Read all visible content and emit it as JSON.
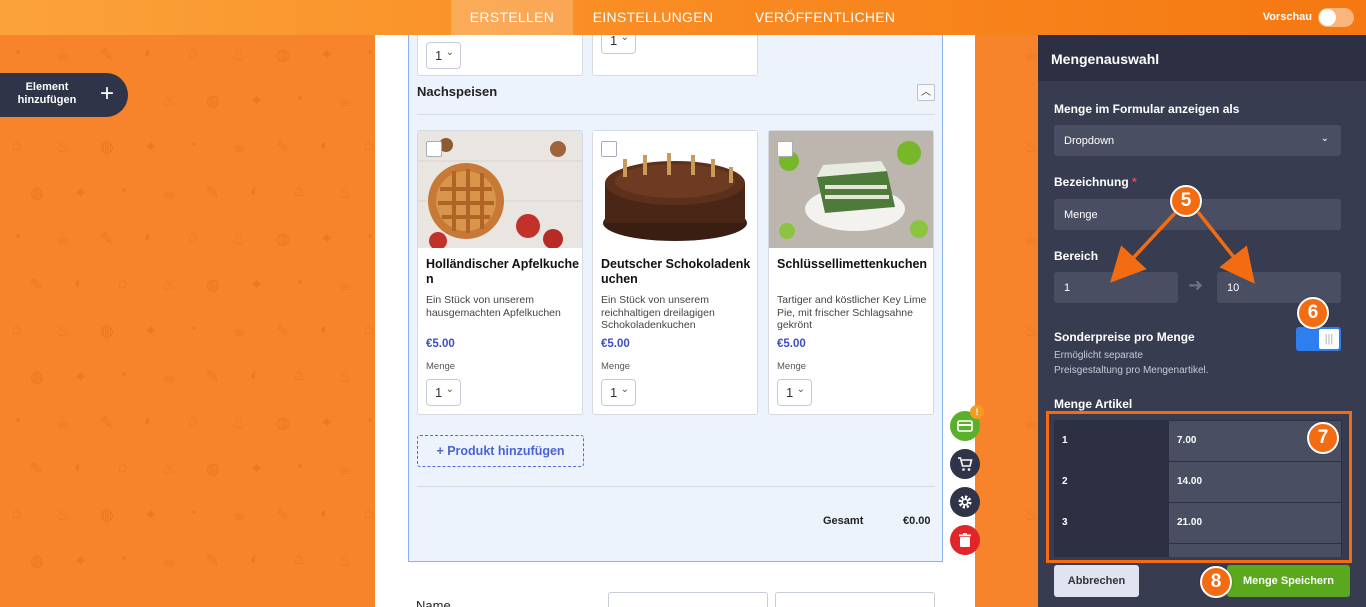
{
  "topbar": {
    "tabs": [
      {
        "label": "ERSTELLEN",
        "active": true
      },
      {
        "label": "EINSTELLUNGEN",
        "active": false
      },
      {
        "label": "VERÖFFENTLICHEN",
        "active": false
      }
    ],
    "preview_label": "Vorschau"
  },
  "sidebar": {
    "add_element_label": "Element hinzufügen"
  },
  "form": {
    "top_qty_values": [
      "1",
      "1"
    ],
    "section_title": "Nachspeisen",
    "products": [
      {
        "name": "Holländischer Apfelkuchen",
        "description": "Ein Stück von unserem hausgemachten Apfelkuchen",
        "price": "€5.00",
        "qty_label": "Menge",
        "qty_value": "1"
      },
      {
        "name": "Deutscher Schokoladenkuchen",
        "description": "Ein Stück von unserem reichhaltigen dreilagigen Schokoladenkuchen",
        "price": "€5.00",
        "qty_label": "Menge",
        "qty_value": "1"
      },
      {
        "name": "Schlüssellimettenkuchen",
        "description": "Tartiger and köstlicher Key Lime Pie, mit frischer Schlagsahne gekrönt",
        "price": "€5.00",
        "qty_label": "Menge",
        "qty_value": "1"
      }
    ],
    "add_product_label": "+ Produkt hinzufügen",
    "total_label": "Gesamt",
    "total_value": "€0.00",
    "name_label": "Name",
    "fab_badge": "!"
  },
  "panel": {
    "title": "Mengenauswahl",
    "display_as_label": "Menge im Formular anzeigen als",
    "display_as_value": "Dropdown",
    "label_label": "Bezeichnung",
    "label_required": "*",
    "label_value": "Menge",
    "range_label": "Bereich",
    "range_from": "1",
    "range_to": "10",
    "special_price_label": "Sonderpreise pro Menge",
    "special_price_desc_1": "Ermöglicht separate",
    "special_price_desc_2": "Preisgestaltung pro Mengenartikel.",
    "special_price_enabled": true,
    "table_label": "Menge Artikel",
    "rows": [
      {
        "qty": "1",
        "price": "7.00"
      },
      {
        "qty": "2",
        "price": "14.00"
      },
      {
        "qty": "3",
        "price": "21.00"
      }
    ],
    "cancel_label": "Abbrechen",
    "save_label": "Menge Speichern"
  },
  "annotations": [
    "5",
    "6",
    "7",
    "8"
  ],
  "colors": {
    "accent": "#f36c12",
    "panel": "#383c51",
    "save": "#5aa81d",
    "toggle": "#2f7ef0"
  }
}
